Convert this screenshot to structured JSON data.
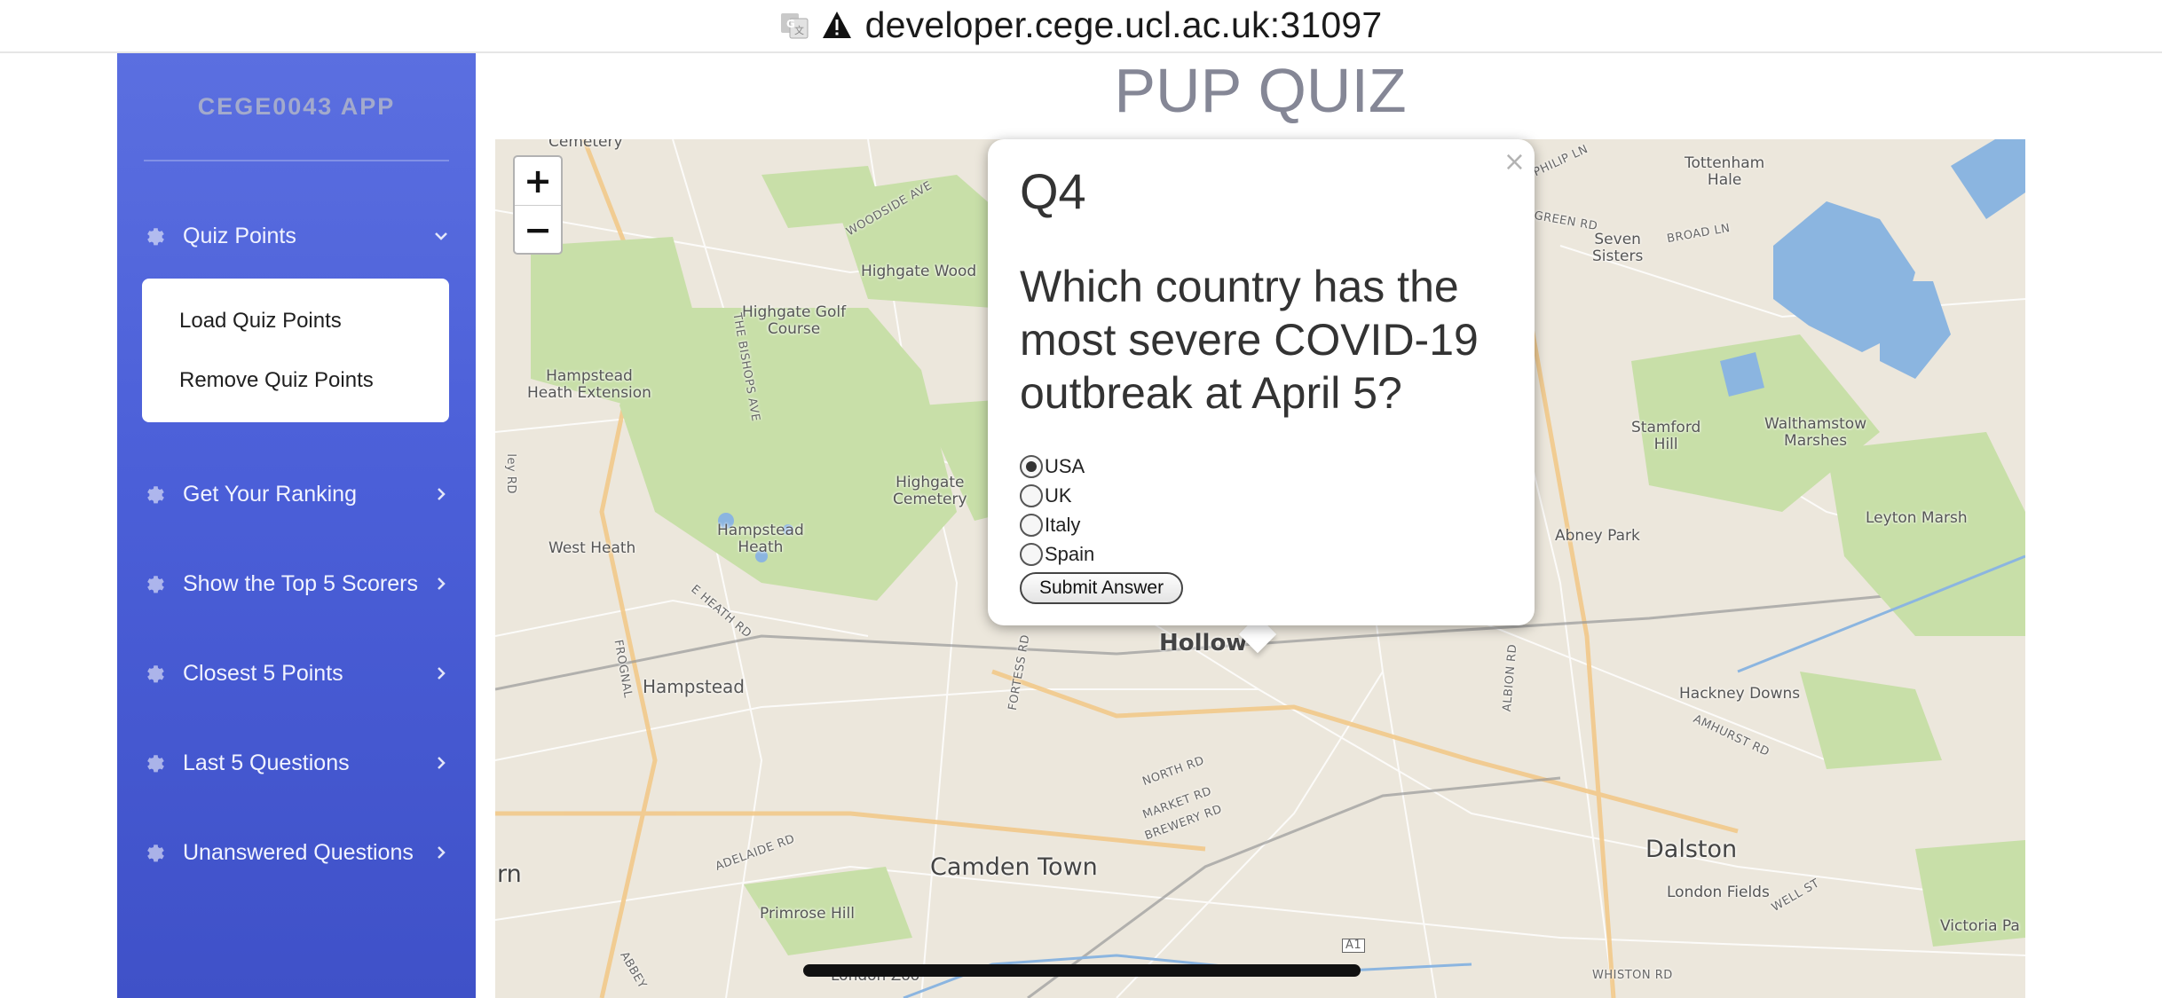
{
  "browser": {
    "url": "developer.cege.ucl.ac.uk:31097",
    "icons": [
      "translate-icon",
      "warning-icon"
    ]
  },
  "sidebar": {
    "brand": "CEGE0043 APP",
    "items": [
      {
        "label": "Quiz Points",
        "icon": "gear-icon",
        "chevron": "chevron-down-icon",
        "expanded": true
      },
      {
        "label": "Get Your Ranking",
        "icon": "gear-icon",
        "chevron": "chevron-right-icon"
      },
      {
        "label": "Show the Top 5 Scorers",
        "icon": "gear-icon",
        "chevron": "chevron-right-icon"
      },
      {
        "label": "Closest 5 Points",
        "icon": "gear-icon",
        "chevron": "chevron-right-icon"
      },
      {
        "label": "Last 5 Questions",
        "icon": "gear-icon",
        "chevron": "chevron-right-icon"
      },
      {
        "label": "Unanswered Questions",
        "icon": "gear-icon",
        "chevron": "chevron-right-icon"
      }
    ],
    "submenu": [
      "Load Quiz Points",
      "Remove Quiz Points"
    ]
  },
  "header": {
    "title": "PUP QUIZ"
  },
  "map": {
    "zoom_in": "+",
    "zoom_out": "−",
    "labels": {
      "cemetery": "Cemetery",
      "philip_ln": "PHILIP LN",
      "tottenham_hale": "Tottenham\nHale",
      "woodside_ave": "WOODSIDE AVE",
      "highgate_wood": "Highgate Wood",
      "highgate_golf": "Highgate Golf\nCourse",
      "green_rd": "GREEN RD",
      "seven_sisters": "Seven\nSisters",
      "broad_ln": "BROAD LN",
      "hampstead_heath_ext": "Hampstead\nHeath Extension",
      "bishops_ave": "THE BISHOPS AVE",
      "stamford_hill": "Stamford\nHill",
      "walthamstow_marshes": "Walthamstow\nMarshes",
      "highgate_cemetery": "Highgate\nCemetery",
      "hampstead_heath": "Hampstead\nHeath",
      "abney_park": "Abney Park",
      "leyton_marsh": "Leyton Marsh",
      "west_heath": "West Heath",
      "e_heath_rd": "E HEATH RD",
      "frognal": "FROGNAL",
      "holloway": "Hollow",
      "fortess_rd": "FORTESS RD",
      "albion_rd": "ALBION RD",
      "hampstead": "Hampstead",
      "hackney_downs": "Hackney Downs",
      "amhurst_rd": "AMHURST RD",
      "north_rd": "NORTH RD",
      "market_rd": "MARKET RD",
      "brewery_rd": "BREWERY RD",
      "adelaide_rd": "ADELAIDE RD",
      "camden_town": "Camden Town",
      "dalston": "Dalston",
      "london_fields": "London Fields",
      "well_st": "WELL ST",
      "primrose_hill": "Primrose Hill",
      "a1": "A1",
      "victoria_park": "Victoria Pa",
      "rn": "rn",
      "abbey": "ABBEY",
      "london_zoo": "London Zoo",
      "whiston_rd": "WHISTON RD",
      "ley": "ley RD"
    }
  },
  "popup": {
    "close": "×",
    "question_number": "Q4",
    "question_text": "Which country has the most severe COVID-19 outbreak at April 5?",
    "options": [
      {
        "label": "USA",
        "checked": true
      },
      {
        "label": "UK",
        "checked": false
      },
      {
        "label": "Italy",
        "checked": false
      },
      {
        "label": "Spain",
        "checked": false
      }
    ],
    "submit_label": "Submit Answer"
  },
  "colors": {
    "sidebar_top": "#5b6fe0",
    "sidebar_bottom": "#3f51c8",
    "map_bg": "#ece7dc",
    "park": "#c8dfa8",
    "water": "#8bb5e0",
    "marker": "#3a82c8"
  }
}
